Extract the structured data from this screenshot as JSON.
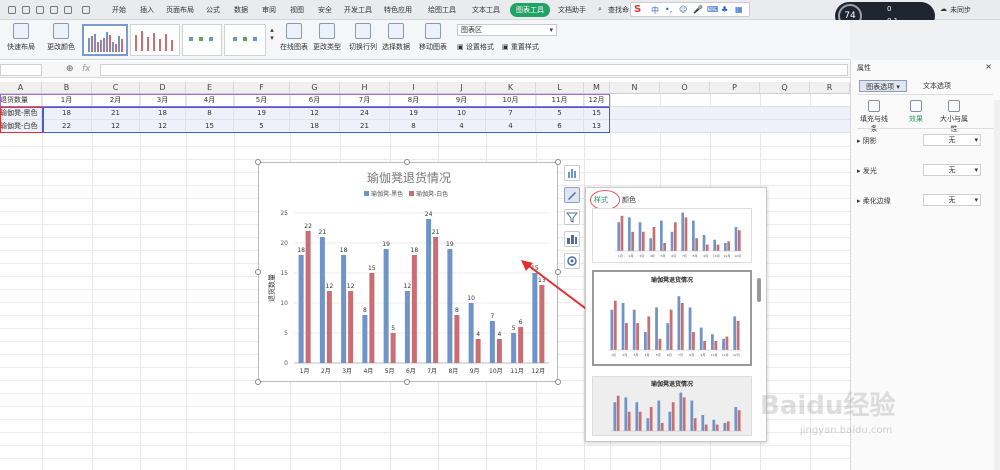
{
  "menu": [
    "开始",
    "插入",
    "页面布局",
    "公式",
    "数据",
    "审阅",
    "视图",
    "安全",
    "开发工具",
    "特色应用",
    "绘图工具",
    "文本工具",
    "图表工具",
    "文档助手"
  ],
  "active_menu": "图表工具",
  "search_text": "查找命",
  "sync_text": "未同步",
  "temp_badge": "74",
  "net_up": "0",
  "net_down": "0.1",
  "ribbon": {
    "quick_layout": "快速布局",
    "change_color": "更改颜色",
    "online_chart": "在线图表",
    "change_type": "更改类型",
    "switch_rowcol": "切换行列",
    "select_data": "选择数据",
    "move_chart": "移动图表",
    "chart_area": "图表区",
    "set_format": "设置格式",
    "reset_style": "重置样式"
  },
  "columns": [
    "A",
    "B",
    "C",
    "D",
    "E",
    "F",
    "G",
    "H",
    "I",
    "J",
    "K",
    "L",
    "M",
    "N",
    "O",
    "P",
    "Q",
    "R"
  ],
  "sheet": {
    "row1": [
      "退货数量",
      "1月",
      "2月",
      "3月",
      "4月",
      "5月",
      "6月",
      "7月",
      "8月",
      "9月",
      "10月",
      "11月",
      "12月"
    ],
    "row2": [
      "瑜伽凳-黑色",
      "18",
      "21",
      "18",
      "8",
      "19",
      "12",
      "24",
      "19",
      "10",
      "7",
      "5",
      "15"
    ],
    "row3": [
      "瑜伽凳-白色",
      "22",
      "12",
      "12",
      "15",
      "5",
      "18",
      "21",
      "8",
      "4",
      "4",
      "6",
      "13"
    ]
  },
  "chart_data": {
    "type": "bar",
    "title": "瑜伽凳退货情况",
    "ylabel": "退货数量",
    "categories": [
      "1月",
      "2月",
      "3月",
      "4月",
      "5月",
      "6月",
      "7月",
      "8月",
      "9月",
      "10月",
      "11月",
      "12月"
    ],
    "series": [
      {
        "name": "瑜伽凳-黑色",
        "values": [
          18,
          21,
          18,
          8,
          19,
          12,
          24,
          19,
          10,
          7,
          5,
          15
        ],
        "color": "#6f94c8"
      },
      {
        "name": "瑜伽凳-白色",
        "values": [
          22,
          12,
          12,
          15,
          5,
          18,
          21,
          8,
          4,
          4,
          6,
          13
        ],
        "color": "#c96f73"
      }
    ],
    "ylim": [
      0,
      25
    ],
    "yticks": [
      0,
      5,
      10,
      15,
      20,
      25
    ],
    "legend": "top"
  },
  "popup": {
    "tab_style": "样式",
    "tab_color": "颜色",
    "thumb_title": "瑜伽凳退货情况"
  },
  "pane": {
    "title": "属性",
    "tab1": "图表选项",
    "tab2": "文本选项",
    "seg1": "填充与线条",
    "seg2": "效果",
    "seg3": "大小与属性",
    "shadow": "阴影",
    "glow": "发光",
    "soft_edge": "柔化边缘",
    "none": "无"
  },
  "watermark": "Baidu经验",
  "watermark_url": "jingyan.baidu.com"
}
